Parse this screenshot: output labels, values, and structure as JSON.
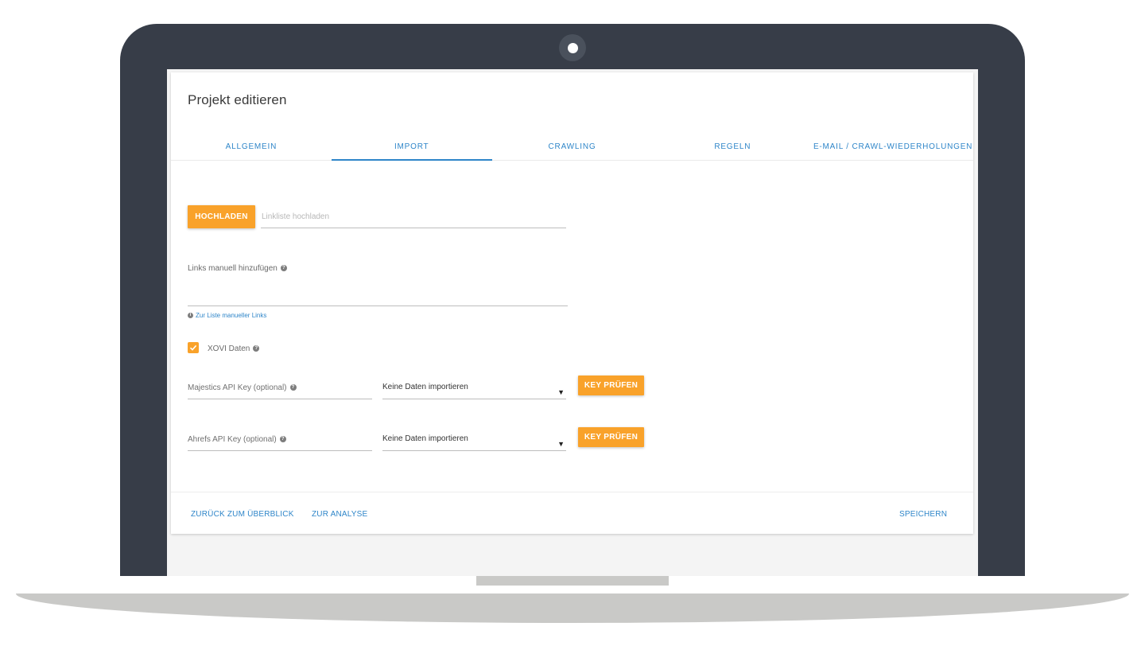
{
  "card": {
    "title": "Projekt editieren"
  },
  "tabs": [
    {
      "label": "ALLGEMEIN",
      "active": false
    },
    {
      "label": "IMPORT",
      "active": true
    },
    {
      "label": "CRAWLING",
      "active": false
    },
    {
      "label": "REGELN",
      "active": false
    },
    {
      "label": "E-MAIL / CRAWL-WIEDERHOLUNGEN",
      "active": false
    }
  ],
  "upload": {
    "button_label": "HOCHLADEN",
    "placeholder": "Linkliste hochladen"
  },
  "manual_links": {
    "label": "Links manuell hinzufügen",
    "value": "",
    "list_link": "Zur Liste manueller Links"
  },
  "xovi": {
    "label": "XOVI Daten",
    "checked": true
  },
  "majestics": {
    "label": "Majestics API Key (optional)",
    "select_value": "Keine Daten importieren",
    "check_button": "KEY PRÜFEN"
  },
  "ahrefs": {
    "label": "Ahrefs API Key (optional)",
    "select_value": "Keine Daten importieren",
    "check_button": "KEY PRÜFEN"
  },
  "footer": {
    "back_label": "ZURÜCK ZUM ÜBERBLICK",
    "analysis_label": "ZUR ANALYSE",
    "save_label": "SPEICHERN"
  },
  "colors": {
    "accent_blue": "#2f86c9",
    "accent_orange": "#f9a22a",
    "bezel": "#373d48"
  }
}
